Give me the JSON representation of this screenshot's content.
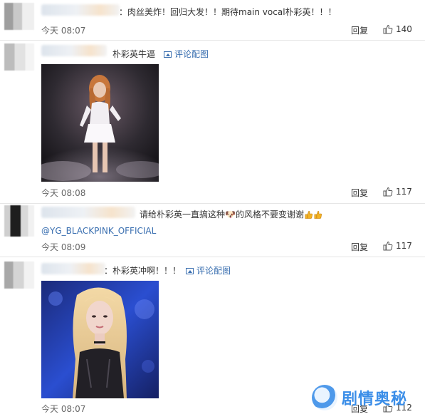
{
  "comments": [
    {
      "text": "：肉丝美炸！回归大发！！期待main vocal朴彩英！！！",
      "time": "今天 08:07",
      "reply": "回复",
      "likes": "140"
    },
    {
      "text": "朴彩英牛逼",
      "image_ref": "评论配图",
      "time": "今天 08:08",
      "reply": "回复",
      "likes": "117"
    },
    {
      "text": "请给朴彩英一直搞这种🐶的风格不要变谢谢",
      "mention": "@YG_BLACKPINK_OFFICIAL",
      "time": "今天 08:09",
      "reply": "回复",
      "likes": "117"
    },
    {
      "text": "：朴彩英冲啊！！！",
      "image_ref": "评论配图",
      "time": "今天 08:07",
      "reply": "回复",
      "likes": "112"
    }
  ],
  "watermark": {
    "text": "剧情奥秘"
  },
  "colors": {
    "link": "#3a6fb0",
    "time": "#666666",
    "text": "#333333",
    "watermark": "#3b8ee8"
  }
}
